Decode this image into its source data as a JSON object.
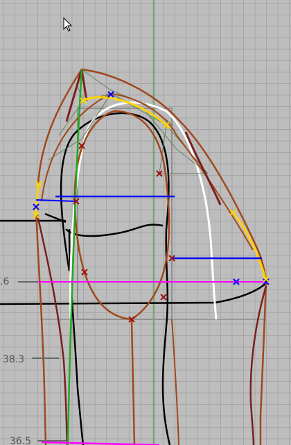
{
  "viewport": {
    "background": "#bdbdbd",
    "grid_color": "#a6a6a6",
    "axis_color": "#3a9a3a"
  },
  "dimensions": [
    {
      "label": ".6"
    },
    {
      "label": "38.3"
    },
    {
      "label": "36.5"
    }
  ],
  "curve_colors": {
    "outline": "#a0481c",
    "outline_dark": "#7a1f1f",
    "shell": "#000000",
    "highlight": "#ffffff",
    "selection": "#ffd400",
    "horizontal_blue": "#0000ff",
    "horizontal_magenta": "#ff00ff",
    "construction": "#5a7a5a",
    "bounding_box": "#8f8f8f",
    "control_point": "#a01010",
    "selected_point": "#0000ff"
  },
  "cursor": {
    "icon": "arrow-pointer-icon"
  }
}
